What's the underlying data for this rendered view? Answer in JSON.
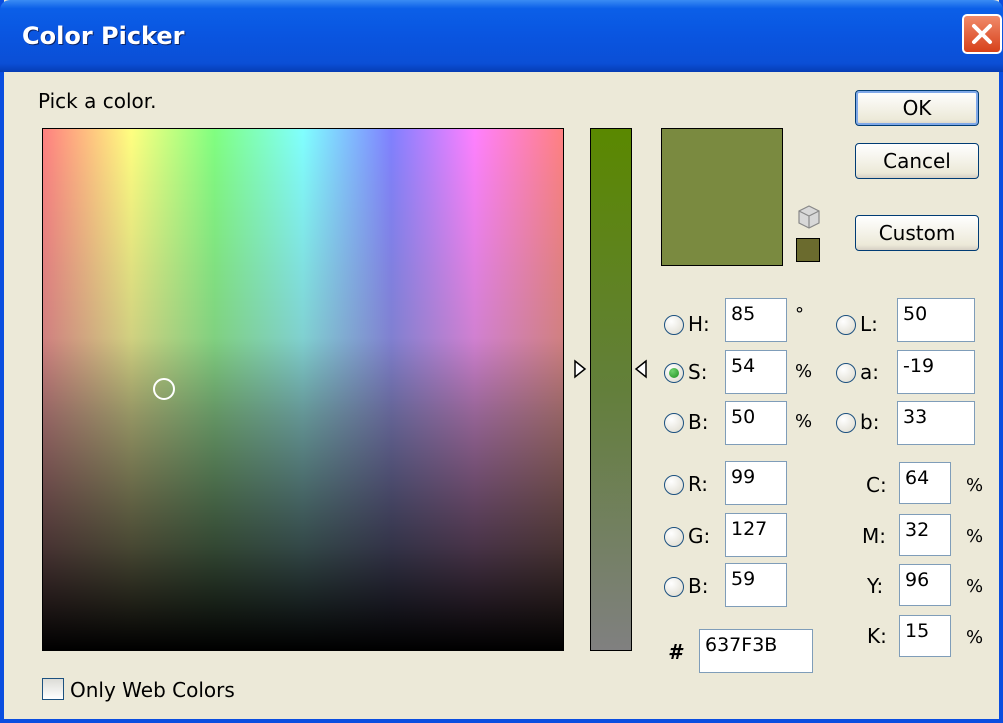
{
  "window": {
    "title": "Color Picker"
  },
  "prompt": "Pick a color.",
  "buttons": {
    "ok": "OK",
    "cancel": "Cancel",
    "custom": "Custom"
  },
  "hsb": {
    "h": {
      "label": "H:",
      "value": "85",
      "unit": "°"
    },
    "s": {
      "label": "S:",
      "value": "54",
      "unit": "%"
    },
    "b": {
      "label": "B:",
      "value": "50",
      "unit": "%"
    }
  },
  "rgb": {
    "r": {
      "label": "R:",
      "value": "99"
    },
    "g": {
      "label": "G:",
      "value": "127"
    },
    "b": {
      "label": "B:",
      "value": "59"
    }
  },
  "lab": {
    "l": {
      "label": "L:",
      "value": "50"
    },
    "a": {
      "label": "a:",
      "value": "-19"
    },
    "b": {
      "label": "b:",
      "value": "33"
    }
  },
  "cmyk": {
    "c": {
      "label": "C:",
      "value": "64",
      "unit": "%"
    },
    "m": {
      "label": "M:",
      "value": "32",
      "unit": "%"
    },
    "y": {
      "label": "Y:",
      "value": "96",
      "unit": "%"
    },
    "k": {
      "label": "K:",
      "value": "15",
      "unit": "%"
    }
  },
  "hex": {
    "label": "#",
    "value": "637F3B"
  },
  "selected_mode": "S",
  "web_colors": {
    "label": "Only Web Colors",
    "checked": false
  },
  "colors": {
    "current": "#637f3b",
    "preview": "#7a8a40",
    "web_swatch": "#6b6b2e",
    "titlebar": "#0a55e0",
    "dialog_bg": "#ece9d8"
  },
  "icons": {
    "close": "close-icon",
    "cube": "out-of-gamut-cube-icon",
    "swatch": "web-safe-swatch-icon"
  }
}
